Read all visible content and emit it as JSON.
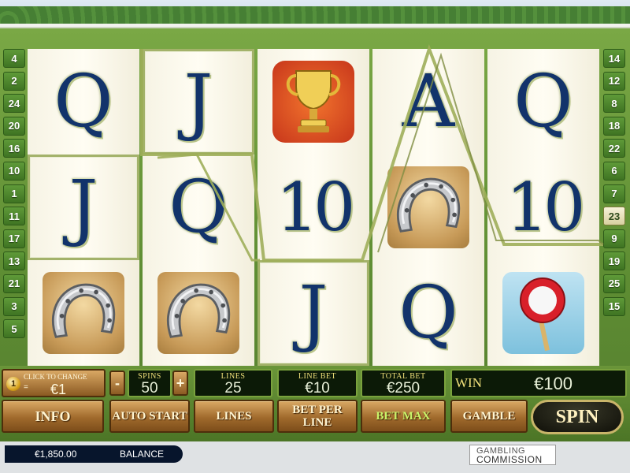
{
  "left_lines": [
    "4",
    "2",
    "24",
    "20",
    "16",
    "10",
    "1",
    "11",
    "17",
    "13",
    "21",
    "3",
    "5"
  ],
  "right_lines": [
    "14",
    "12",
    "8",
    "18",
    "22",
    "6",
    "7",
    "23",
    "9",
    "19",
    "25",
    "15"
  ],
  "reels": [
    [
      {
        "type": "letter",
        "text": "Q"
      },
      {
        "type": "letter",
        "text": "J",
        "boxed": true
      },
      {
        "type": "icon",
        "name": "horseshoe-icon"
      }
    ],
    [
      {
        "type": "letter",
        "text": "J",
        "boxed": true
      },
      {
        "type": "letter",
        "text": "Q"
      },
      {
        "type": "icon",
        "name": "horseshoe-icon"
      }
    ],
    [
      {
        "type": "icon",
        "name": "trophy-icon"
      },
      {
        "type": "letter",
        "text": "10"
      },
      {
        "type": "letter",
        "text": "J",
        "boxed": true
      }
    ],
    [
      {
        "type": "letter",
        "text": "A"
      },
      {
        "type": "icon",
        "name": "horseshoe-icon"
      },
      {
        "type": "letter",
        "text": "Q"
      }
    ],
    [
      {
        "type": "letter",
        "text": "Q"
      },
      {
        "type": "letter",
        "text": "10"
      },
      {
        "type": "icon",
        "name": "finish-post-sign-icon"
      }
    ]
  ],
  "panel": {
    "coin_caption": "CLICK TO CHANGE",
    "coin_number": "1",
    "coin_value": "€1",
    "spins_label": "SPINS",
    "spins_value": "50",
    "minus": "-",
    "plus": "+",
    "lines_label": "LINES",
    "lines_value": "25",
    "line_bet_label": "LINE BET",
    "line_bet_value": "€10",
    "total_bet_label": "TOTAL BET",
    "total_bet_value": "€250",
    "win_label": "WIN",
    "win_value": "€100",
    "buttons": {
      "info": "INFO",
      "auto_start": "AUTO START",
      "lines": "LINES",
      "bet_per_line": "BET PER LINE",
      "bet_max": "BET MAX",
      "gamble": "GAMBLE",
      "spin": "SPIN"
    }
  },
  "footer": {
    "balance_amount": "€1,850.00",
    "balance_label": "BALANCE",
    "gc_line1": "GAMBLING",
    "gc_line2": "COMMISSION"
  },
  "highlighted_line": "23"
}
